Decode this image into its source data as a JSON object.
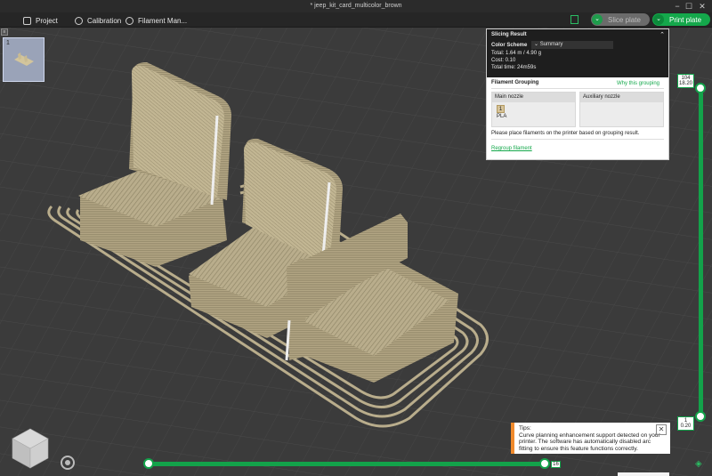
{
  "window": {
    "title": "* jeep_kit_card_multicolor_brown"
  },
  "toolbar": {
    "project": "Project",
    "calibration": "Calibration",
    "filament": "Filament Man...",
    "slice_plate": "Slice plate",
    "print_plate": "Print plate"
  },
  "plate": {
    "number": "1"
  },
  "slicing": {
    "title": "Slicing Result",
    "color_scheme_label": "Color Scheme",
    "color_scheme_value": "Summary",
    "total": "Total:  1.64 m / 4.90 g",
    "cost": "Cost:  0.10",
    "time": "Total time:  24m59s"
  },
  "grouping": {
    "title": "Filament Grouping",
    "why_link": "Why this grouping",
    "main_nozzle": "Main nozzle",
    "aux_nozzle": "Auxiliary nozzle",
    "filament_num": "1",
    "filament_type": "PLA",
    "message": "Please place filaments on the printer based on grouping result.",
    "regroup": "Regroup filament"
  },
  "layer_slider": {
    "top_layer": "104",
    "top_height": "18.20",
    "bottom_layer": "1",
    "bottom_height": "0.20"
  },
  "move_slider": {
    "value": "16"
  },
  "tips": {
    "title": "Tips:",
    "text": "Curve planning enhancement support detected on your printer. The software has automatically disabled arc fitting to ensure this feature functions correctly."
  },
  "colors": {
    "accent": "#14a84b",
    "filament": "#b9ad8c",
    "warning": "#f08a2c"
  }
}
